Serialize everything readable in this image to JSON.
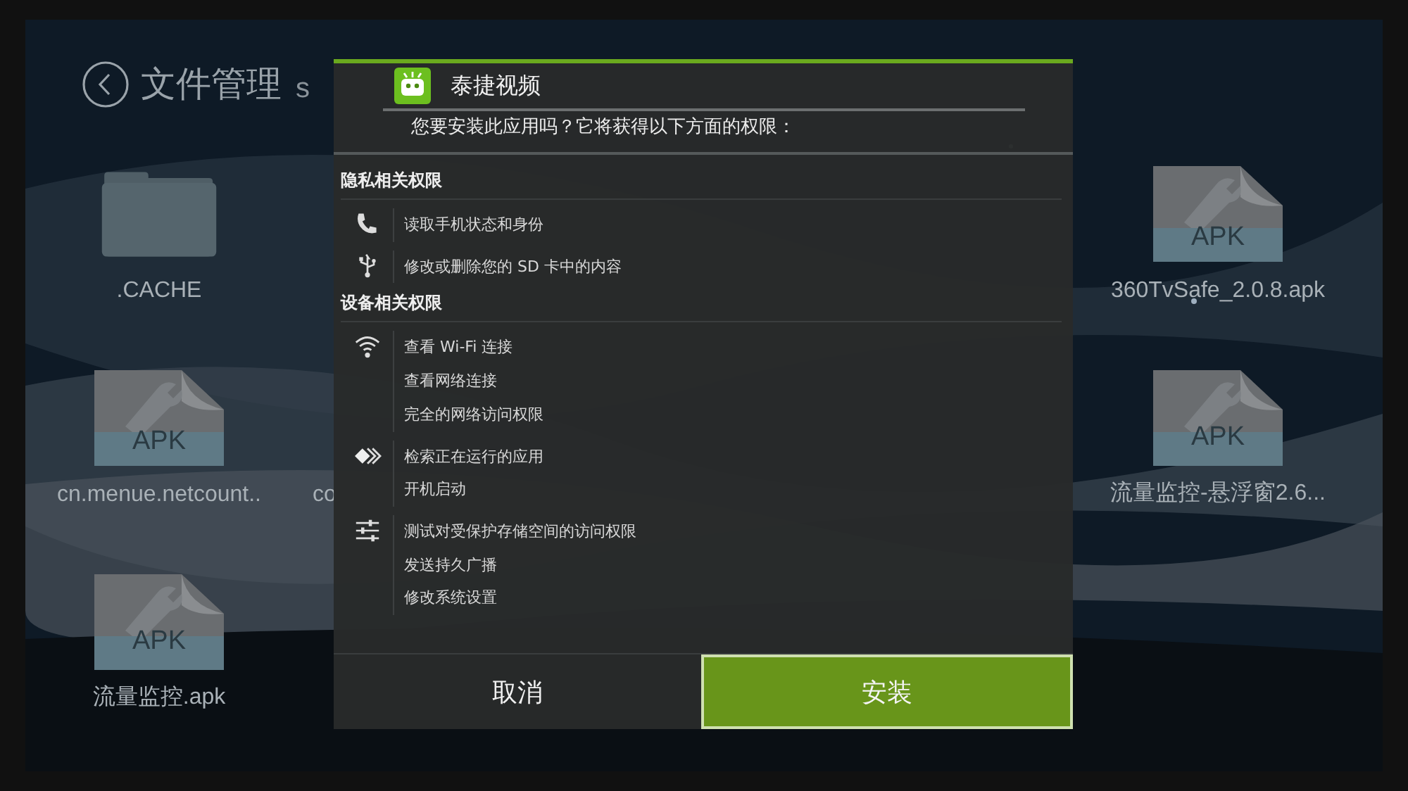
{
  "header": {
    "title": "文件管理",
    "subtitle": "s"
  },
  "files": [
    {
      "kind": "folder",
      "name": ".CACHE"
    },
    {
      "kind": "apk",
      "badge": "APK",
      "name": "360TvSafe_2.0.8.apk"
    },
    {
      "kind": "apk",
      "badge": "APK",
      "name": "cn.menue.netcount.."
    },
    {
      "kind": "partial",
      "name": "co"
    },
    {
      "kind": "apk",
      "badge": "APK",
      "name": "流量监控-悬浮窗2.6..."
    },
    {
      "kind": "apk",
      "badge": "APK",
      "name": "流量监控.apk"
    }
  ],
  "dialog": {
    "app_name": "泰捷视频",
    "question": "您要安装此应用吗？它将获得以下方面的权限：",
    "sections": [
      {
        "title": "隐私相关权限",
        "groups": [
          {
            "kind": "phone",
            "items": [
              "读取手机状态和身份"
            ]
          },
          {
            "kind": "usb",
            "items": [
              "修改或删除您的 SD 卡中的内容"
            ]
          }
        ]
      },
      {
        "title": "设备相关权限",
        "groups": [
          {
            "kind": "wifi",
            "items": [
              "查看 Wi-Fi 连接",
              "查看网络连接",
              "完全的网络访问权限"
            ]
          },
          {
            "kind": "apps",
            "items": [
              "检索正在运行的应用",
              "开机启动"
            ]
          },
          {
            "kind": "sliders",
            "items": [
              "测试对受保护存储空间的访问权限",
              "发送持久广播",
              "修改系统设置"
            ]
          }
        ]
      }
    ],
    "buttons": [
      {
        "label": "取消",
        "selected": false
      },
      {
        "label": "安装",
        "selected": true
      }
    ]
  }
}
